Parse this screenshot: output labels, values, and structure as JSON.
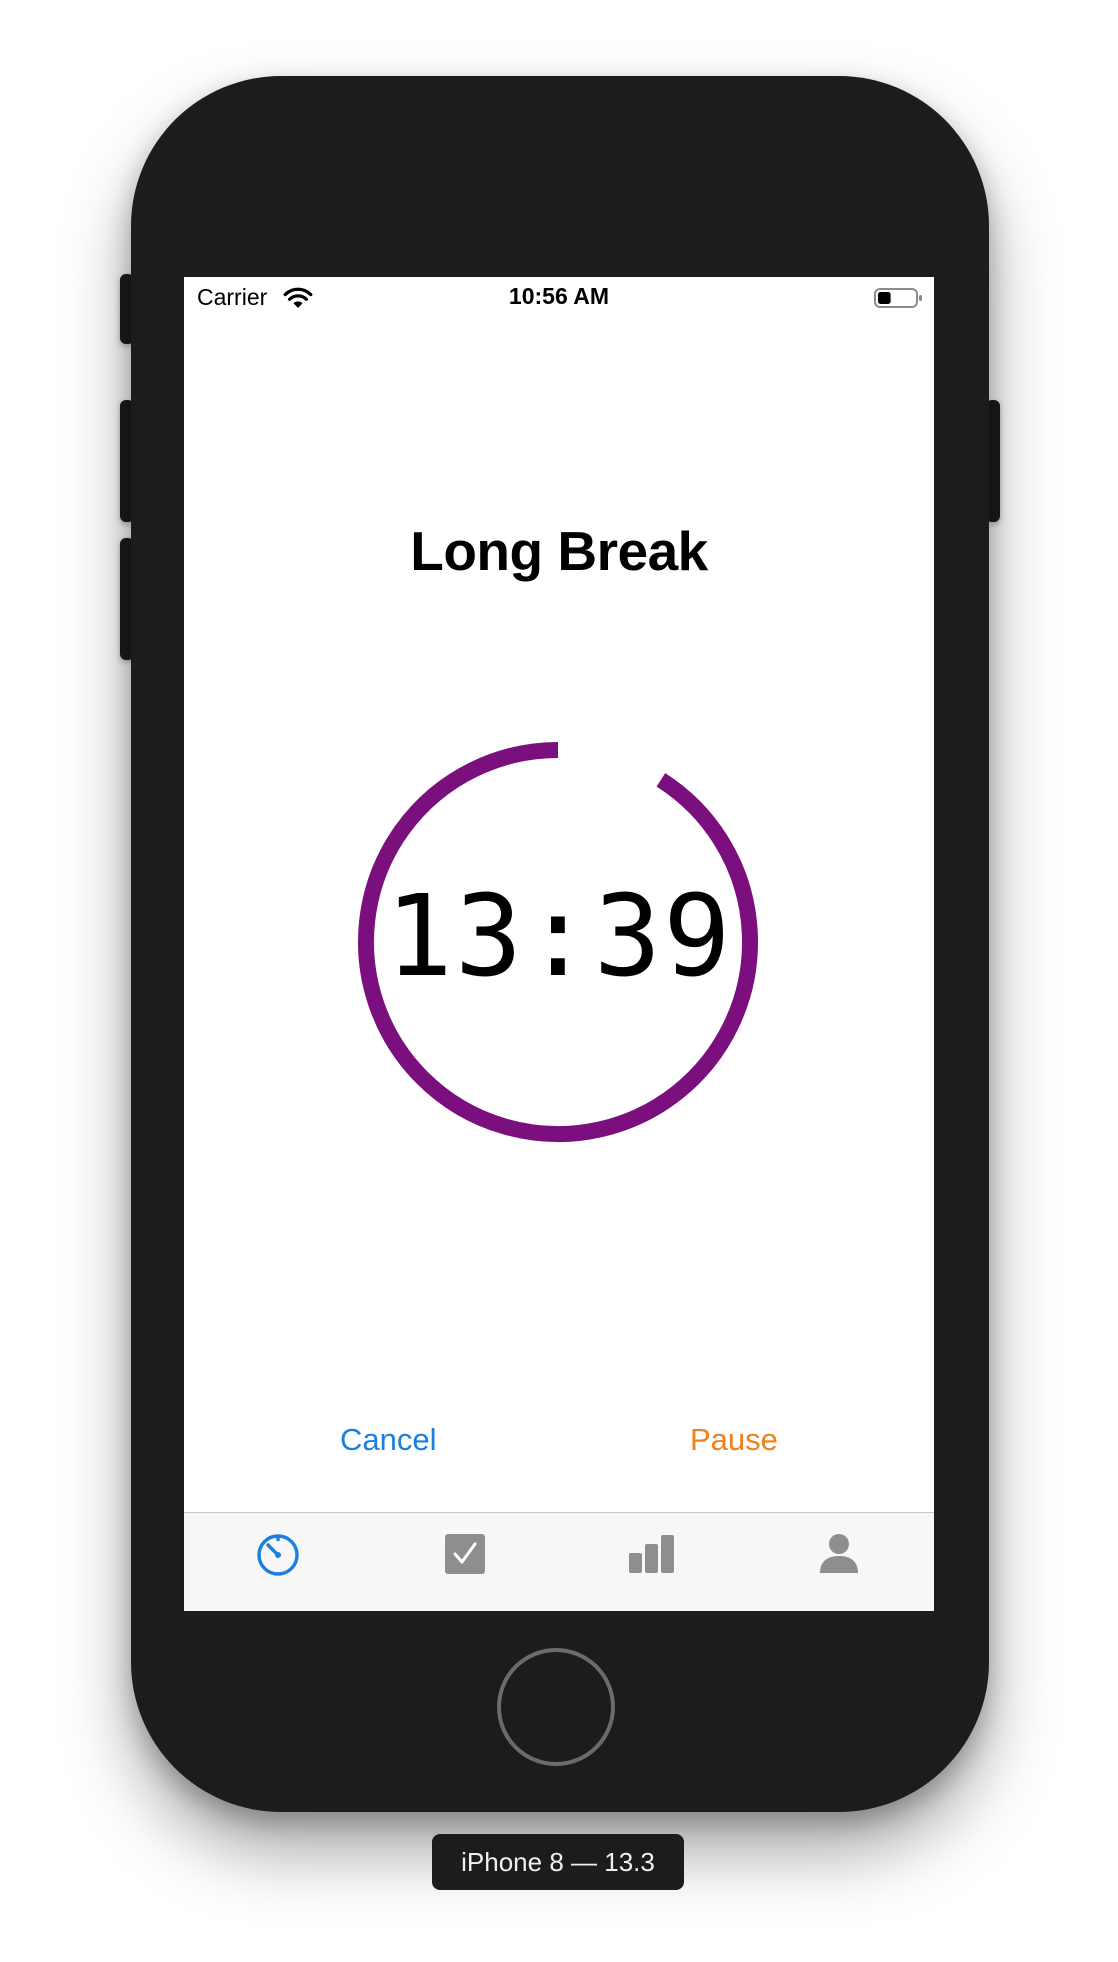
{
  "status_bar": {
    "carrier": "Carrier",
    "time": "10:56 AM",
    "wifi_icon": "wifi-icon",
    "battery_icon": "battery-icon",
    "battery_level": 0.35
  },
  "timer": {
    "title": "Long Break",
    "time": "13:39",
    "ring_color": "#7b0f7e",
    "progress_remaining": 0.91
  },
  "actions": {
    "cancel_label": "Cancel",
    "cancel_color": "#1a7fe0",
    "pause_label": "Pause",
    "pause_color": "#f0801a"
  },
  "tab_bar": {
    "items": [
      {
        "icon": "timer-icon",
        "selected": true
      },
      {
        "icon": "checkbox-icon",
        "selected": false
      },
      {
        "icon": "bar-chart-icon",
        "selected": false
      },
      {
        "icon": "person-icon",
        "selected": false
      }
    ],
    "selected_color": "#1a7fe0",
    "unselected_color": "#8e8e8e"
  },
  "device_label": "iPhone 8 — 13.3"
}
